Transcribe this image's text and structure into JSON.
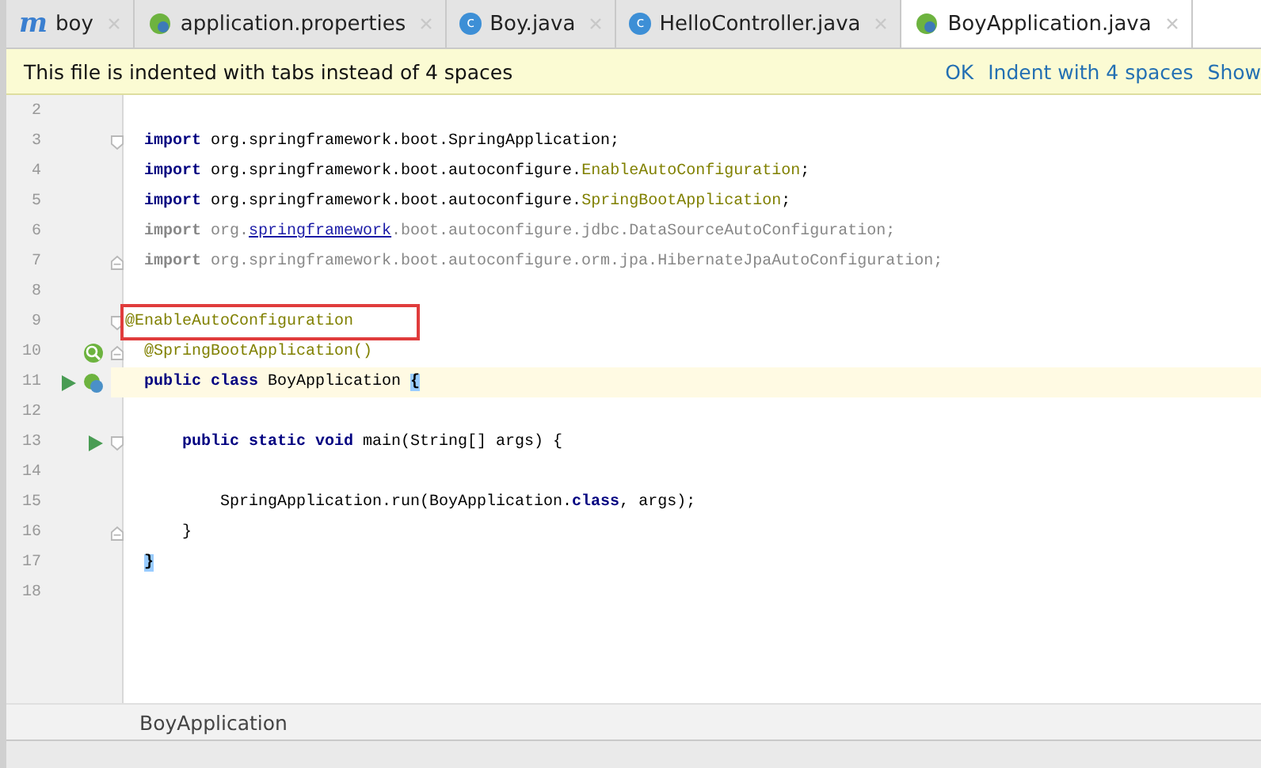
{
  "tabs": [
    {
      "label": "boy",
      "kind": "maven",
      "glyph": "m",
      "selected": false
    },
    {
      "label": "application.properties",
      "kind": "spring",
      "selected": false
    },
    {
      "label": "Boy.java",
      "kind": "class",
      "glyph": "c",
      "selected": false
    },
    {
      "label": "HelloController.java",
      "kind": "class",
      "glyph": "c",
      "selected": false
    },
    {
      "label": "BoyApplication.java",
      "kind": "spring",
      "selected": true
    }
  ],
  "notification": {
    "message": "This file is indented with tabs instead of 4 spaces",
    "actions": [
      "OK",
      "Indent with 4 spaces",
      "Show"
    ]
  },
  "editor": {
    "lines": [
      {
        "number": "2"
      },
      {
        "number": "3",
        "fold": {
          "kind": "open"
        },
        "tokens": [
          {
            "text": "import",
            "kind": "keyword"
          },
          {
            "text": " org.springframework.boot.SpringApplication;",
            "kind": "plain"
          }
        ]
      },
      {
        "number": "4",
        "tokens": [
          {
            "text": "import",
            "kind": "keyword"
          },
          {
            "text": " org.springframework.boot.autoconfigure.",
            "kind": "plain"
          },
          {
            "text": "EnableAutoConfiguration",
            "kind": "annotation"
          },
          {
            "text": ";",
            "kind": "plain"
          }
        ]
      },
      {
        "number": "5",
        "tokens": [
          {
            "text": "import",
            "kind": "keyword"
          },
          {
            "text": " org.springframework.boot.autoconfigure.",
            "kind": "plain"
          },
          {
            "text": "SpringBootApplication",
            "kind": "annotation"
          },
          {
            "text": ";",
            "kind": "plain"
          }
        ]
      },
      {
        "number": "6",
        "tokens": [
          {
            "text": "import",
            "kind": "unused-keyword"
          },
          {
            "text": " org.",
            "kind": "unused"
          },
          {
            "text": "springframework",
            "kind": "link"
          },
          {
            "text": ".boot.autoconfigure.jdbc.DataSourceAutoConfiguration;",
            "kind": "unused"
          }
        ]
      },
      {
        "number": "7",
        "fold": {
          "kind": "close"
        },
        "tokens": [
          {
            "text": "import",
            "kind": "unused-keyword"
          },
          {
            "text": " org.springframework.boot.autoconfigure.orm.jpa.HibernateJpaAutoConfiguration;",
            "kind": "unused"
          }
        ]
      },
      {
        "number": "8"
      },
      {
        "number": "9",
        "fold": {
          "kind": "open"
        },
        "boxed": true,
        "tokens": [
          {
            "text": "@EnableAutoConfiguration",
            "kind": "annotation"
          }
        ]
      },
      {
        "number": "10",
        "fold": {
          "kind": "close"
        },
        "gutter": [
          {
            "kind": "bean-search"
          }
        ],
        "tokens": [
          {
            "text": "@SpringBootApplication()",
            "kind": "annotation"
          }
        ]
      },
      {
        "number": "11",
        "current": true,
        "gutter": [
          {
            "kind": "run"
          },
          {
            "kind": "bean"
          }
        ],
        "tokens": [
          {
            "text": "public class ",
            "kind": "keyword"
          },
          {
            "text": "BoyApplication ",
            "kind": "plain"
          },
          {
            "text": "{",
            "kind": "matched"
          }
        ]
      },
      {
        "number": "12"
      },
      {
        "number": "13",
        "fold": {
          "kind": "open"
        },
        "gutter": [
          {
            "kind": "run"
          }
        ],
        "tokens": [
          {
            "text": "    public static void ",
            "kind": "keyword"
          },
          {
            "text": "main(String[] args) {",
            "kind": "plain"
          }
        ]
      },
      {
        "number": "14"
      },
      {
        "number": "15",
        "tokens": [
          {
            "text": "        SpringApplication.run(BoyApplication.",
            "kind": "plain"
          },
          {
            "text": "class",
            "kind": "keyword"
          },
          {
            "text": ", args);",
            "kind": "plain"
          }
        ]
      },
      {
        "number": "16",
        "fold": {
          "kind": "close"
        },
        "tokens": [
          {
            "text": "    }",
            "kind": "plain"
          }
        ]
      },
      {
        "number": "17",
        "tokens": [
          {
            "text": "}",
            "kind": "matched"
          }
        ]
      },
      {
        "number": "18"
      }
    ]
  },
  "breadcrumb": "BoyApplication"
}
